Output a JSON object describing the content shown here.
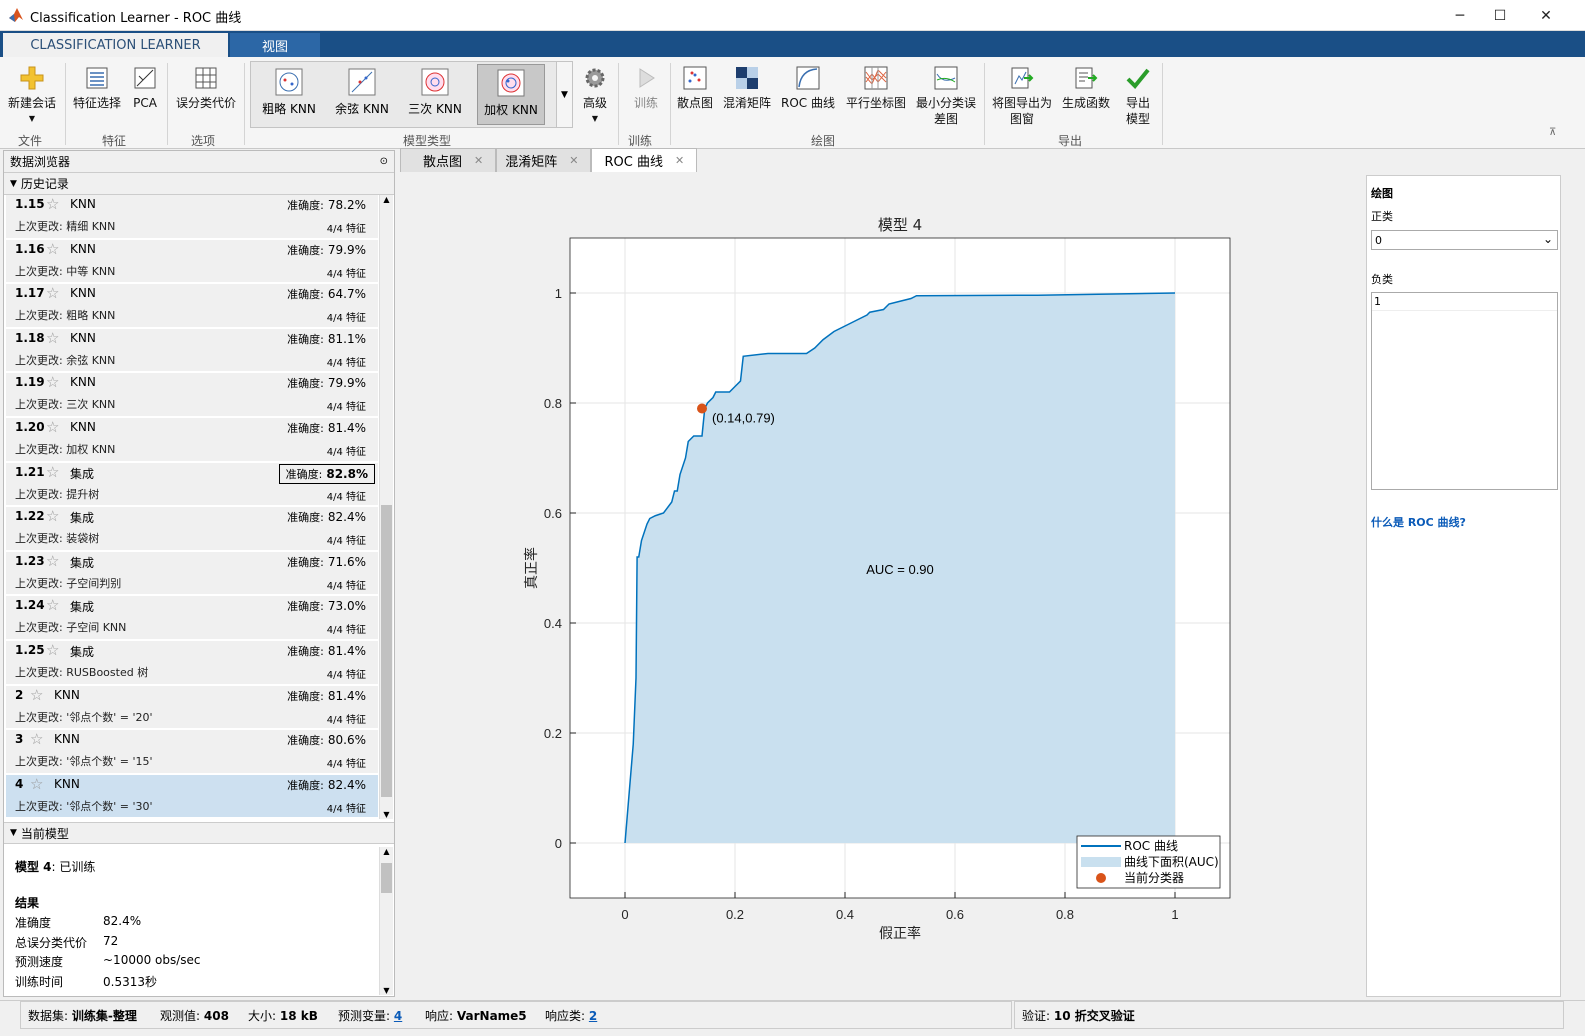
{
  "window": {
    "title": "Classification Learner - ROC 曲线"
  },
  "ribbon_tabs": [
    {
      "label": "CLASSIFICATION LEARNER"
    },
    {
      "label": "视图"
    }
  ],
  "ribbon": {
    "new_session": "新建会话",
    "feature_select": "特征选择",
    "pca": "PCA",
    "misclass_cost": "误分类代价",
    "gallery": [
      "粗略 KNN",
      "余弦 KNN",
      "三次 KNN",
      "加权 KNN"
    ],
    "advanced": "高级",
    "train": "训练",
    "plots": [
      "散点图",
      "混淆矩阵",
      "ROC 曲线",
      "平行坐标图"
    ],
    "min_err_1": "最小分类误",
    "min_err_2": "差图",
    "export_fig_1": "将图导出为",
    "export_fig_2": "图窗",
    "gen_func": "生成函数",
    "export_model_1": "导出",
    "export_model_2": "模型",
    "groups": {
      "file": "文件",
      "feature": "特征",
      "options": "选项",
      "model_type": "模型类型",
      "training": "训练",
      "plot": "绘图",
      "export": "导出"
    }
  },
  "left": {
    "browser_title": "数据浏览器",
    "history_title": "历史记录",
    "acc_label": "准确度:",
    "changed_label": "上次更改:",
    "feat_label": "4/4 特征",
    "models": [
      {
        "id": "1.15",
        "type": "KNN",
        "change": "精细 KNN",
        "acc": "78.2%"
      },
      {
        "id": "1.16",
        "type": "KNN",
        "change": "中等 KNN",
        "acc": "79.9%"
      },
      {
        "id": "1.17",
        "type": "KNN",
        "change": "粗略 KNN",
        "acc": "64.7%"
      },
      {
        "id": "1.18",
        "type": "KNN",
        "change": "余弦 KNN",
        "acc": "81.1%"
      },
      {
        "id": "1.19",
        "type": "KNN",
        "change": "三次 KNN",
        "acc": "79.9%"
      },
      {
        "id": "1.20",
        "type": "KNN",
        "change": "加权 KNN",
        "acc": "81.4%"
      },
      {
        "id": "1.21",
        "type": "集成",
        "change": "提升树",
        "acc": "82.8%"
      },
      {
        "id": "1.22",
        "type": "集成",
        "change": "装袋树",
        "acc": "82.4%"
      },
      {
        "id": "1.23",
        "type": "集成",
        "change": "子空间判别",
        "acc": "71.6%"
      },
      {
        "id": "1.24",
        "type": "集成",
        "change": "子空间 KNN",
        "acc": "73.0%"
      },
      {
        "id": "1.25",
        "type": "集成",
        "change": "RUSBoosted 树",
        "acc": "81.4%"
      },
      {
        "id": "2",
        "type": "KNN",
        "change": "'邻点个数' = '20'",
        "acc": "81.4%"
      },
      {
        "id": "3",
        "type": "KNN",
        "change": "'邻点个数' = '15'",
        "acc": "80.6%"
      },
      {
        "id": "4",
        "type": "KNN",
        "change": "'邻点个数' = '30'",
        "acc": "82.4%"
      }
    ],
    "current_title": "当前模型",
    "current": {
      "heading_bold": "模型 4",
      "heading_rest": ": 已训练",
      "results_label": "结果",
      "rows": [
        {
          "k": "准确度",
          "v": "82.4%"
        },
        {
          "k": "总误分类代价",
          "v": "72"
        },
        {
          "k": "预测速度",
          "v": "~10000 obs/sec"
        },
        {
          "k": "训练时间",
          "v": "0.5313秒"
        }
      ]
    }
  },
  "doc_tabs": [
    {
      "label": "散点图"
    },
    {
      "label": "混淆矩阵"
    },
    {
      "label": "ROC 曲线"
    }
  ],
  "chart_data": {
    "type": "line",
    "title": "模型 4",
    "xlabel": "假正率",
    "ylabel": "真正率",
    "xlim": [
      -0.1,
      1.1
    ],
    "ylim": [
      -0.1,
      1.1
    ],
    "xticks": [
      "0",
      "0.2",
      "0.4",
      "0.6",
      "0.8",
      "1"
    ],
    "yticks": [
      "0",
      "0.2",
      "0.4",
      "0.6",
      "0.8",
      "1"
    ],
    "grid": true,
    "legend_position": "bottom-right",
    "series": [
      {
        "name": "ROC 曲线",
        "color": "#0072bd",
        "x": [
          0,
          0.015,
          0.02,
          0.022,
          0.025,
          0.03,
          0.04,
          0.045,
          0.055,
          0.07,
          0.085,
          0.09,
          0.095,
          0.1,
          0.11,
          0.115,
          0.125,
          0.14,
          0.145,
          0.15,
          0.16,
          0.165,
          0.19,
          0.2,
          0.21,
          0.215,
          0.26,
          0.275,
          0.33,
          0.345,
          0.36,
          0.38,
          0.4,
          0.42,
          0.44,
          0.445,
          0.47,
          0.48,
          0.5,
          0.52,
          0.53,
          0.75,
          1.0
        ],
        "y": [
          0,
          0.18,
          0.3,
          0.52,
          0.52,
          0.55,
          0.58,
          0.59,
          0.595,
          0.6,
          0.62,
          0.64,
          0.64,
          0.67,
          0.7,
          0.73,
          0.74,
          0.74,
          0.79,
          0.8,
          0.81,
          0.82,
          0.82,
          0.83,
          0.84,
          0.885,
          0.89,
          0.89,
          0.89,
          0.9,
          0.915,
          0.93,
          0.94,
          0.95,
          0.96,
          0.965,
          0.97,
          0.98,
          0.985,
          0.99,
          0.995,
          0.996,
          1.0
        ]
      }
    ],
    "area_legend": "曲线下面积(AUC)",
    "area_color": "#c9e0ef",
    "auc_text": "AUC = 0.90",
    "point": {
      "x": 0.14,
      "y": 0.79,
      "label": "(0.14,0.79)",
      "legend": "当前分类器",
      "color": "#d95319"
    }
  },
  "right": {
    "plot_label": "绘图",
    "positive_label": "正类",
    "positive_value": "0",
    "negative_label": "负类",
    "negative_value": "1",
    "help_link": "什么是 ROC 曲线?"
  },
  "status": {
    "dataset_label": "数据集:",
    "dataset": "训练集-整理",
    "obs_label": "观测值:",
    "obs": "408",
    "size_label": "大小:",
    "size": "18 kB",
    "pred_label": "预测变量:",
    "pred": "4",
    "resp_label": "响应:",
    "resp": "VarName5",
    "classes_label": "响应类:",
    "classes": "2",
    "validation_label": "验证:",
    "validation": "10 折交叉验证"
  }
}
